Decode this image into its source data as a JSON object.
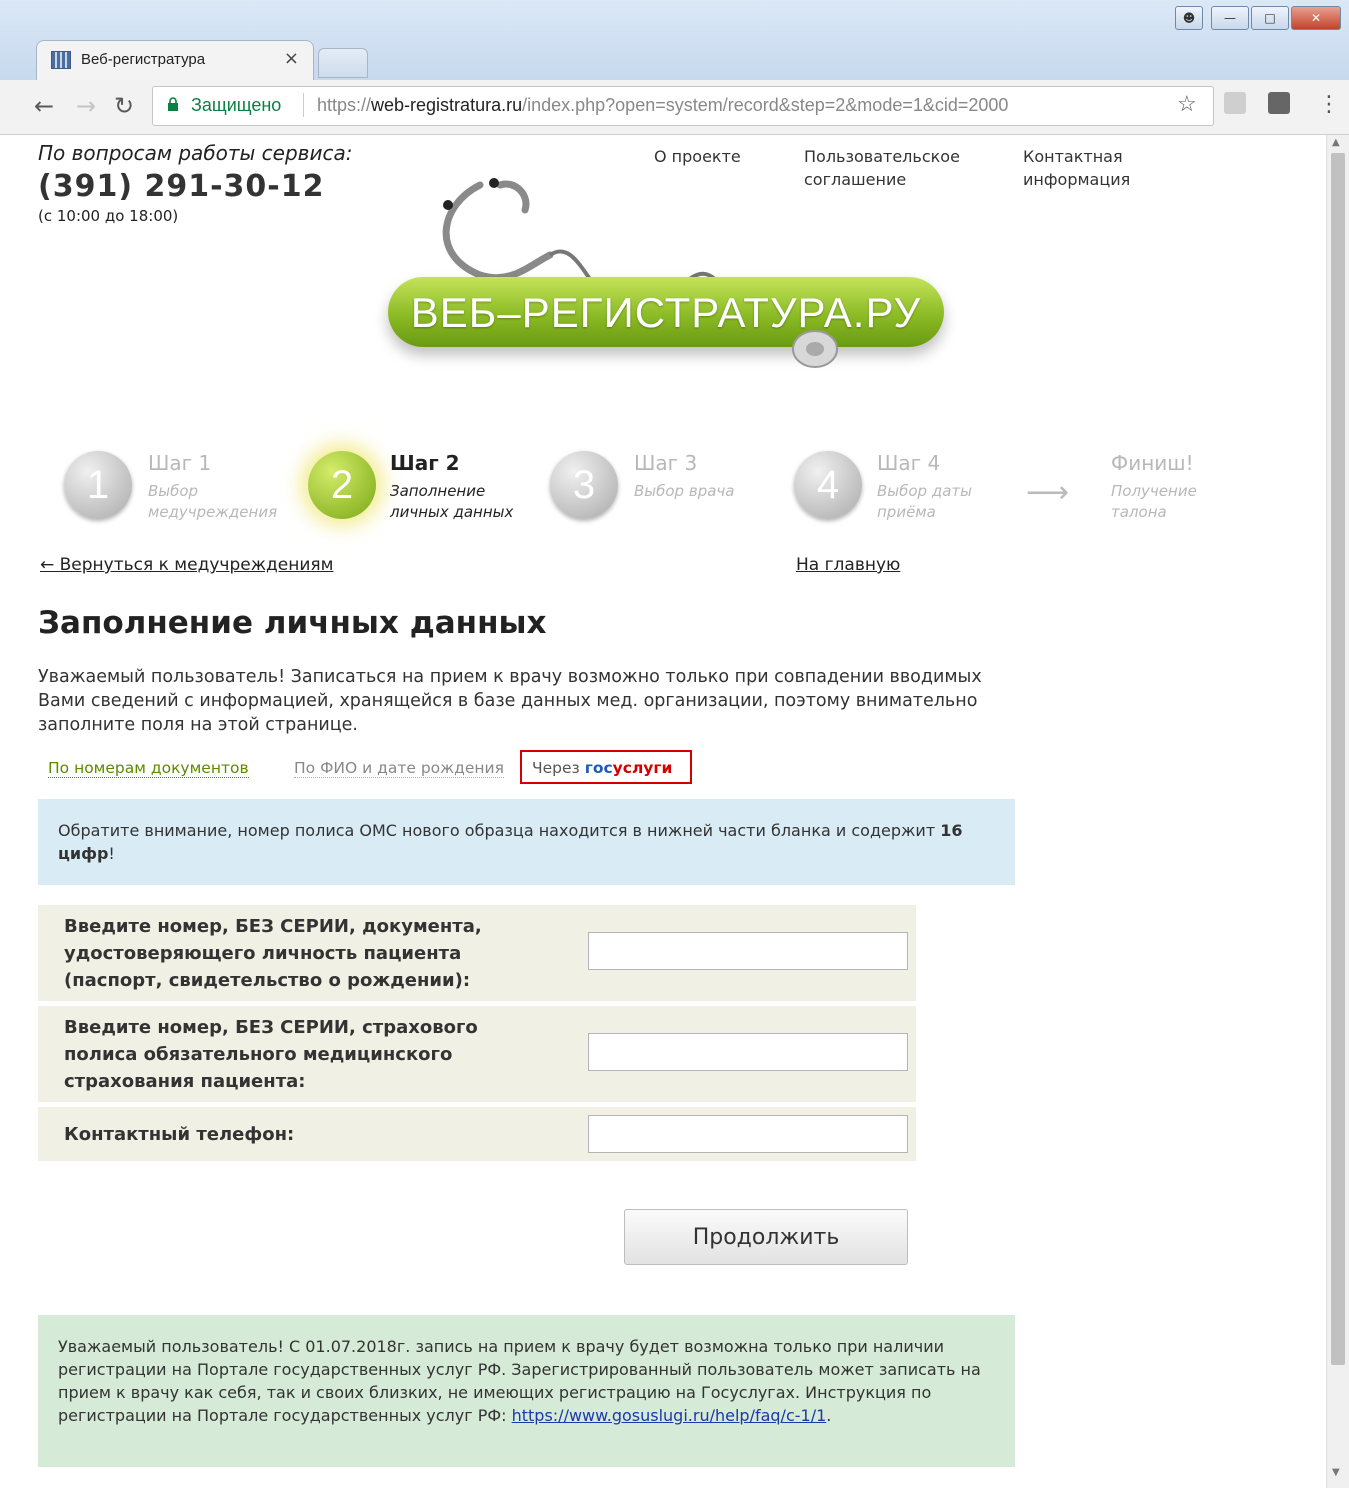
{
  "browser": {
    "tab_title": "Веб-регистратура",
    "tab_close": "×",
    "secure_label": "Защищено",
    "url_scheme": "https://",
    "url_host": "web-registratura.ru",
    "url_path": "/index.php?open=system/record&step=2&mode=1&cid=2000"
  },
  "header": {
    "support_label": "По вопросам работы сервиса:",
    "support_phone": "(391) 291-30-12",
    "support_hours": "(с 10:00 до 18:00)",
    "nav": [
      {
        "label": "О проекте"
      },
      {
        "label": "Пользовательское соглашение"
      },
      {
        "label": "Контактная информация"
      }
    ],
    "logo_text": "ВЕБ–РЕГИСТРАТУРА.РУ"
  },
  "steps": [
    {
      "num": "1",
      "title": "Шаг 1",
      "sub": "Выбор медучреждения"
    },
    {
      "num": "2",
      "title": "Шаг 2",
      "sub": "Заполнение личных данных"
    },
    {
      "num": "3",
      "title": "Шаг 3",
      "sub": "Выбор врача"
    },
    {
      "num": "4",
      "title": "Шаг 4",
      "sub": "Выбор даты приёма"
    },
    {
      "num": "",
      "title": "Финиш!",
      "sub": "Получение талона"
    }
  ],
  "links": {
    "back": "← Вернуться к медучреждениям",
    "home": "На главную"
  },
  "page_title": "Заполнение личных данных",
  "intro": "Уважаемый пользователь! Записаться на прием к врачу возможно только при совпадении вводимых Вами сведений с информацией, хранящейся в базе данных мед. организации, поэтому внимательно заполните поля на этой странице.",
  "mode_tabs": {
    "docs": "По номерам документов",
    "fio": "По ФИО и дате рождения",
    "gos_prefix": "Через ",
    "gos_blue": "гос",
    "gos_red": "услуги"
  },
  "notice": {
    "text": "Обратите внимание, номер полиса ОМС нового образца находится в нижней части бланка и содержит ",
    "bold": "16 цифр",
    "end": "!"
  },
  "form": {
    "doc_label": "Введите номер, БЕЗ СЕРИИ, документа, удостоверяющего личность пациента (паспорт, свидетельство о рождении):",
    "oms_label": "Введите номер, БЕЗ СЕРИИ, страхового полиса обязательного медицинского страхования пациента:",
    "phone_label": "Контактный телефон:",
    "doc_value": "",
    "oms_value": "",
    "phone_value": ""
  },
  "continue_label": "Продолжить",
  "gos_notice": {
    "text": "Уважаемый пользователь! С 01.07.2018г. запись на прием к врачу будет возможна только при наличии регистрации на Портале государственных услуг РФ. Зарегистрированный пользователь может записать на прием к врачу как себя, так и своих близких, не имеющих регистрацию на Госуслугах. Инструкция по регистрации на Портале государственных услуг РФ: ",
    "link": "https://www.gosuslugi.ru/help/faq/c-1/1",
    "end": "."
  },
  "colors": {
    "accent_green": "#8bbb25",
    "gos_blue": "#1e5bb8",
    "gos_red": "#d40000",
    "highlight_border": "#d40000"
  }
}
